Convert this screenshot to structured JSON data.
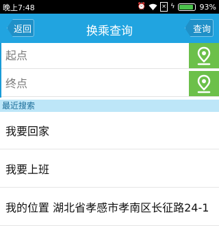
{
  "status_bar": {
    "time": "晚上7:48",
    "battery": "93%",
    "battery_level": 0.93,
    "icons": [
      "alarm-icon",
      "wifi-icon",
      "sim-off-icon",
      "charging-icon"
    ]
  },
  "header": {
    "back_label": "返回",
    "title": "换乘查询",
    "query_label": "查询"
  },
  "search": {
    "start_placeholder": "起点",
    "end_placeholder": "终点",
    "location_icon": "location-pin-icon"
  },
  "recent": {
    "header": "最近搜索",
    "items": [
      {
        "label": "我要回家"
      },
      {
        "label": "我要上班"
      },
      {
        "label": "我的位置 湖北省孝感市孝南区长征路24-1"
      }
    ]
  },
  "colors": {
    "header_bg": "#21a4e0",
    "location_button": "#6cc04a",
    "recent_header_bg": "#bde6f8"
  }
}
